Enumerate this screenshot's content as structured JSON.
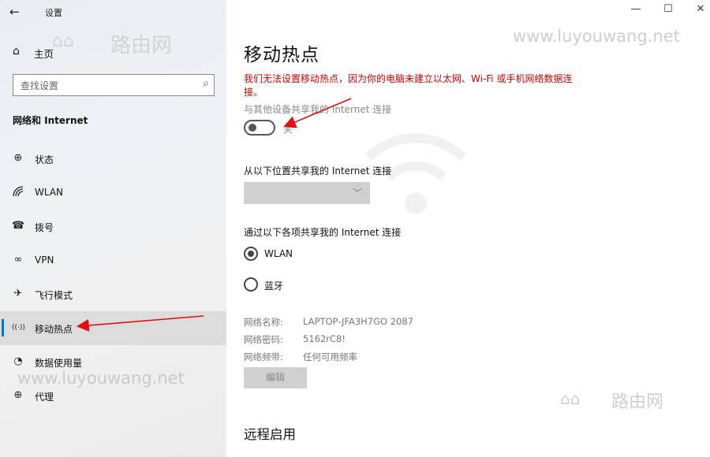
{
  "window": {
    "title": "设置",
    "controls": {
      "minimize": "—",
      "maximize": "☐",
      "close": "✕"
    }
  },
  "sidebar": {
    "back_icon": "←",
    "home_label": "主页",
    "search_placeholder": "查找设置",
    "section_title": "网络和 Internet",
    "items": [
      {
        "label": "状态",
        "icon": "globe-icon",
        "glyph": "⊕"
      },
      {
        "label": "WLAN",
        "icon": "wifi-icon",
        "glyph": "◜"
      },
      {
        "label": "拨号",
        "icon": "dialup-icon",
        "glyph": "☎"
      },
      {
        "label": "VPN",
        "icon": "vpn-icon",
        "glyph": "∞"
      },
      {
        "label": "飞行模式",
        "icon": "airplane-icon",
        "glyph": "✈"
      },
      {
        "label": "移动热点",
        "icon": "hotspot-icon",
        "glyph": "((·))",
        "active": true
      },
      {
        "label": "数据使用量",
        "icon": "data-usage-icon",
        "glyph": "◔"
      },
      {
        "label": "代理",
        "icon": "proxy-icon",
        "glyph": "⊕"
      }
    ]
  },
  "main": {
    "title": "移动热点",
    "error": "我们无法设置移动热点，因为你的电脑未建立以太网、Wi-Fi 或手机网络数据连接。",
    "share_label": "与其他设备共享我的 Internet 连接",
    "toggle_state": "关",
    "from_label": "从以下位置共享我的 Internet 连接",
    "via_label": "通过以下各项共享我的 Internet 连接",
    "radio_options": [
      {
        "label": "WLAN",
        "checked": true
      },
      {
        "label": "蓝牙",
        "checked": false
      }
    ],
    "info": [
      {
        "key": "网络名称:",
        "value": "LAPTOP-JFA3H7GO 2087"
      },
      {
        "key": "网络密码:",
        "value": "5162rC8!"
      },
      {
        "key": "网络频带:",
        "value": "任何可用频率"
      }
    ],
    "edit_label": "编辑",
    "remote_title": "远程启用"
  },
  "watermarks": {
    "url": "www.luyouwang.net",
    "brand": "路由网"
  },
  "colors": {
    "accent": "#0078d7",
    "error": "#d00000",
    "arrow": "#e01010"
  }
}
